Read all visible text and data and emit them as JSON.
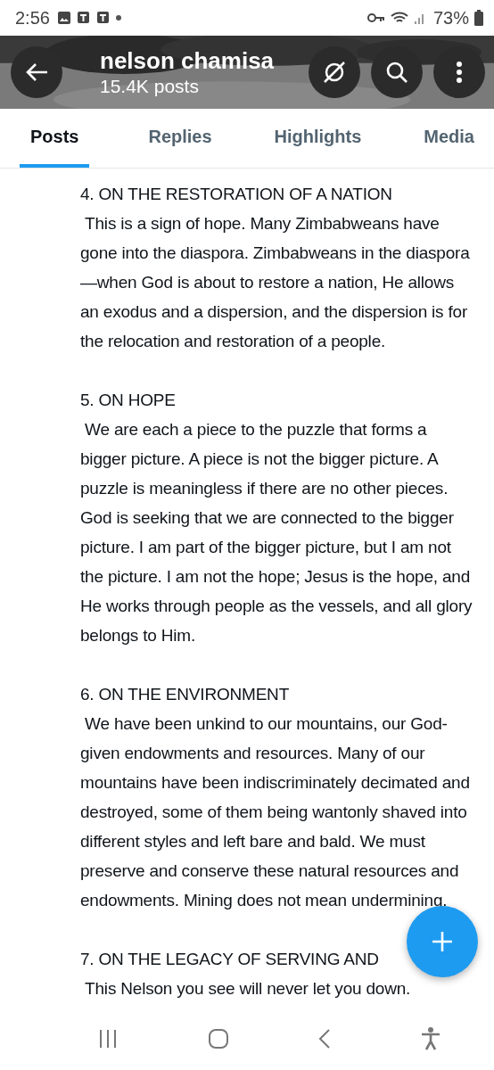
{
  "status_bar": {
    "time": "2:56",
    "battery": "73%"
  },
  "header": {
    "name": "nelson chamisa",
    "posts": "15.4K posts"
  },
  "tabs": [
    {
      "label": "Posts",
      "selected": true
    },
    {
      "label": "Replies",
      "selected": false
    },
    {
      "label": "Highlights",
      "selected": false
    },
    {
      "label": "Media",
      "selected": false
    }
  ],
  "sections": [
    {
      "heading": "4. ON THE RESTORATION OF A NATION",
      "body": " This is a sign of hope. Many Zimbabweans have gone into the diaspora. Zimbabweans in the diaspora—when God is about to restore a nation, He allows an exodus and a dispersion, and the dispersion is for the relocation and restoration of a people."
    },
    {
      "heading": "5. ON HOPE",
      "body": " We are each a piece to the puzzle that forms a bigger picture. A piece is not the bigger picture. A puzzle is meaningless if there are no other pieces. God is seeking that we are connected to the bigger picture. I am part of the bigger picture, but I am not the picture. I am not the hope; Jesus is the hope, and He works through people as the vessels, and all glory belongs to Him."
    },
    {
      "heading": "6. ON THE ENVIRONMENT",
      "body": " We have been unkind to our mountains, our God-given endowments and resources. Many of our mountains have been indiscriminately decimated and destroyed, some of them being wantonly shaved into different styles and left bare and bald. We must preserve and conserve these natural resources and endowments. Mining does not mean undermining."
    },
    {
      "heading": "7. ON THE LEGACY OF SERVING AND",
      "body": " This Nelson you see will never let you down."
    }
  ]
}
